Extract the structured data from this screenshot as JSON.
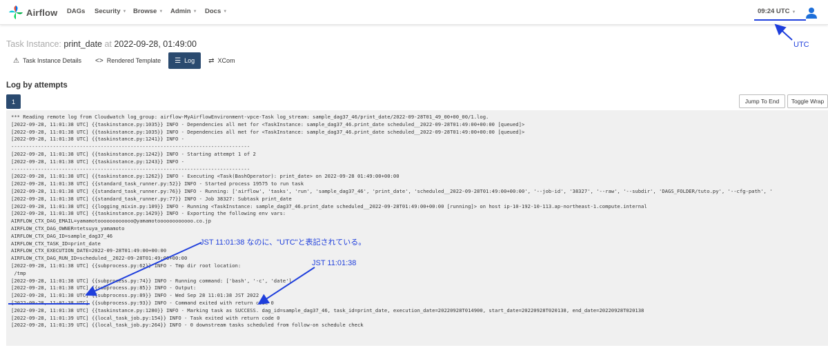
{
  "navbar": {
    "brand": "Airflow",
    "items": [
      {
        "label": "DAGs",
        "dropdown": false
      },
      {
        "label": "Security",
        "dropdown": true
      },
      {
        "label": "Browse",
        "dropdown": true
      },
      {
        "label": "Admin",
        "dropdown": true
      },
      {
        "label": "Docs",
        "dropdown": true
      }
    ],
    "clock": "09:24 UTC",
    "user_icon": "user-icon"
  },
  "task_instance": {
    "label": "Task Instance:",
    "task_id": "print_date",
    "at": "at",
    "date": "2022-09-28, 01:49:00"
  },
  "tabs": [
    {
      "label": "Task Instance Details",
      "icon": "warning-icon",
      "active": false
    },
    {
      "label": "Rendered Template",
      "icon": "code-icon",
      "active": false
    },
    {
      "label": "Log",
      "icon": "list-icon",
      "active": true
    },
    {
      "label": "XCom",
      "icon": "exchange-icon",
      "active": false
    }
  ],
  "log_section": {
    "title": "Log by attempts",
    "attempt": "1",
    "jump_to_end": "Jump To End",
    "toggle_wrap": "Toggle Wrap"
  },
  "log_lines": [
    "*** Reading remote log from Cloudwatch log_group: airflow-MyAirflowEnvironment-vpce-Task log_stream: sample_dag37_46/print_date/2022-09-28T01_49_00+00_00/1.log.",
    "[2022-09-28, 11:01:38 UTC] {{taskinstance.py:1035}} INFO - Dependencies all met for <TaskInstance: sample_dag37_46.print_date scheduled__2022-09-28T01:49:00+00:00 [queued]>",
    "[2022-09-28, 11:01:38 UTC] {{taskinstance.py:1035}} INFO - Dependencies all met for <TaskInstance: sample_dag37_46.print_date scheduled__2022-09-28T01:49:00+00:00 [queued]>",
    "[2022-09-28, 11:01:38 UTC] {{taskinstance.py:1241}} INFO -",
    "--------------------------------------------------------------------------------",
    "[2022-09-28, 11:01:38 UTC] {{taskinstance.py:1242}} INFO - Starting attempt 1 of 2",
    "[2022-09-28, 11:01:38 UTC] {{taskinstance.py:1243}} INFO -",
    "--------------------------------------------------------------------------------",
    "[2022-09-28, 11:01:38 UTC] {{taskinstance.py:1262}} INFO - Executing <Task(BashOperator): print_date> on 2022-09-28 01:49:00+00:00",
    "[2022-09-28, 11:01:38 UTC] {{standard_task_runner.py:52}} INFO - Started process 19575 to run task",
    "[2022-09-28, 11:01:38 UTC] {{standard_task_runner.py:76}} INFO - Running: ['airflow', 'tasks', 'run', 'sample_dag37_46', 'print_date', 'scheduled__2022-09-28T01:49:00+00:00', '--job-id', '38327', '--raw', '--subdir', 'DAGS_FOLDER/tuto.py', '--cfg-path', '",
    "[2022-09-28, 11:01:38 UTC] {{standard_task_runner.py:77}} INFO - Job 38327: Subtask print_date",
    "[2022-09-28, 11:01:38 UTC] {{logging_mixin.py:109}} INFO - Running <TaskInstance: sample_dag37_46.print_date scheduled__2022-09-28T01:49:00+00:00 [running]> on host ip-10-192-10-113.ap-northeast-1.compute.internal",
    "[2022-09-28, 11:01:38 UTC] {{taskinstance.py:1429}} INFO - Exporting the following env vars:",
    "AIRFLOW_CTX_DAG_EMAIL=yamamotoooooooooooo@yamamotoooooooooooo.co.jp",
    "AIRFLOW_CTX_DAG_OWNER=tetsuya_yamamoto",
    "AIRFLOW_CTX_DAG_ID=sample_dag37_46",
    "AIRFLOW_CTX_TASK_ID=print_date",
    "AIRFLOW_CTX_EXECUTION_DATE=2022-09-28T01:49:00+00:00",
    "AIRFLOW_CTX_DAG_RUN_ID=scheduled__2022-09-28T01:49:00+00:00",
    "[2022-09-28, 11:01:38 UTC] {{subprocess.py:62}} INFO - Tmp dir root location:",
    " /tmp",
    "[2022-09-28, 11:01:38 UTC] {{subprocess.py:74}} INFO - Running command: ['bash', '-c', 'date']",
    "[2022-09-28, 11:01:38 UTC] {{subprocess.py:85}} INFO - Output:",
    "[2022-09-28, 11:01:38 UTC] {{subprocess.py:89}} INFO - Wed Sep 28 11:01:38 JST 2022",
    "[2022-09-28, 11:01:38 UTC] {{subprocess.py:93}} INFO - Command exited with return code 0",
    "[2022-09-28, 11:01:38 UTC] {{taskinstance.py:1280}} INFO - Marking task as SUCCESS. dag_id=sample_dag37_46, task_id=print_date, execution_date=20220928T014900, start_date=20220928T020138, end_date=20220928T020138",
    "[2022-09-28, 11:01:39 UTC] {{local_task_job.py:154}} INFO - Task exited with return code 0",
    "[2022-09-28, 11:01:39 UTC] {{local_task_job.py:264}} INFO - 0 downstream tasks scheduled from follow-on schedule check"
  ],
  "annotations": {
    "utc": "UTC",
    "jst_utc_note": "JST 11:01:38 なのに、\"UTC\"と表記されている。",
    "jst_time": "JST 11:01:38",
    "color": "#1f3fdc"
  },
  "colors": {
    "active_tab": "#2a4a6f",
    "log_bg": "#f0f0f0"
  }
}
